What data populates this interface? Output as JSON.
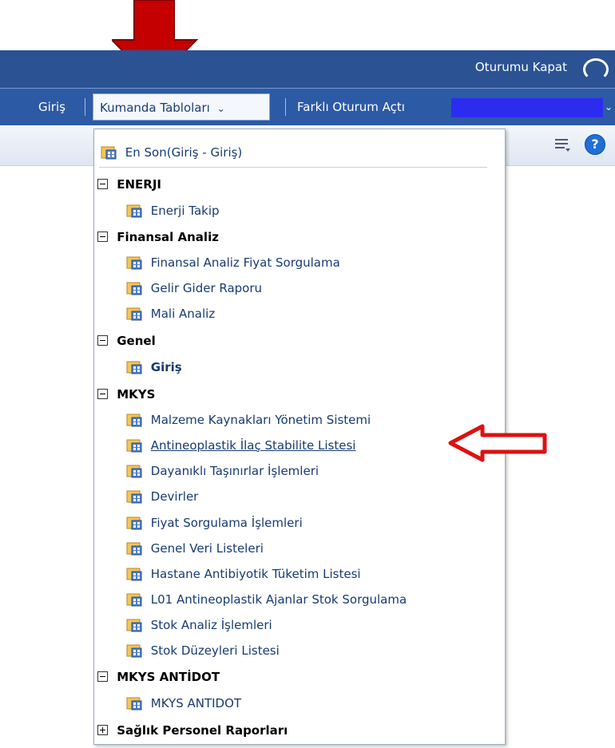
{
  "header": {
    "logout_label": "Oturumu Kapat"
  },
  "nav": {
    "home": "Giriş",
    "dashboards": "Kumanda Tabloları",
    "dashboards_chevron": "⌄",
    "switch_session": "Farklı Oturum Açtı",
    "right_chevron": "⌄"
  },
  "toolbar": {
    "help_glyph": "?"
  },
  "menu": {
    "recent": "En Son(Giriş - Giriş)",
    "groups": [
      {
        "label": "ENERJI",
        "items": [
          "Enerji Takip"
        ]
      },
      {
        "label": "Finansal Analiz",
        "items": [
          "Finansal Analiz Fiyat Sorgulama",
          "Gelir Gider Raporu",
          "Mali Analiz"
        ]
      },
      {
        "label": "Genel",
        "items": [
          "Giriş"
        ]
      },
      {
        "label": "MKYS",
        "items": [
          "Malzeme Kaynakları Yönetim Sistemi",
          "Antineoplastik İlaç Stabilite Listesi",
          "Dayanıklı Taşınırlar İşlemleri",
          "Devirler",
          "Fiyat Sorgulama İşlemleri",
          "Genel Veri Listeleri",
          "Hastane Antibiyotik Tüketim Listesi",
          "L01 Antineoplastik Ajanlar Stok Sorgulama",
          "Stok Analiz İşlemleri",
          "Stok Düzeyleri Listesi"
        ]
      },
      {
        "label": "MKYS ANTİDOT",
        "items": [
          "MKYS ANTIDOT"
        ]
      },
      {
        "label": "Sağlık Personel Raporları",
        "items": []
      }
    ]
  },
  "colors": {
    "topbar": "#2b5293",
    "navbar": "#2d5aa5",
    "menu_text": "#173b73",
    "annotation_red": "#cc0000"
  },
  "icons": [
    "dashboard-icon",
    "collapse-icon",
    "expand-icon",
    "list-options-icon",
    "help-icon"
  ]
}
